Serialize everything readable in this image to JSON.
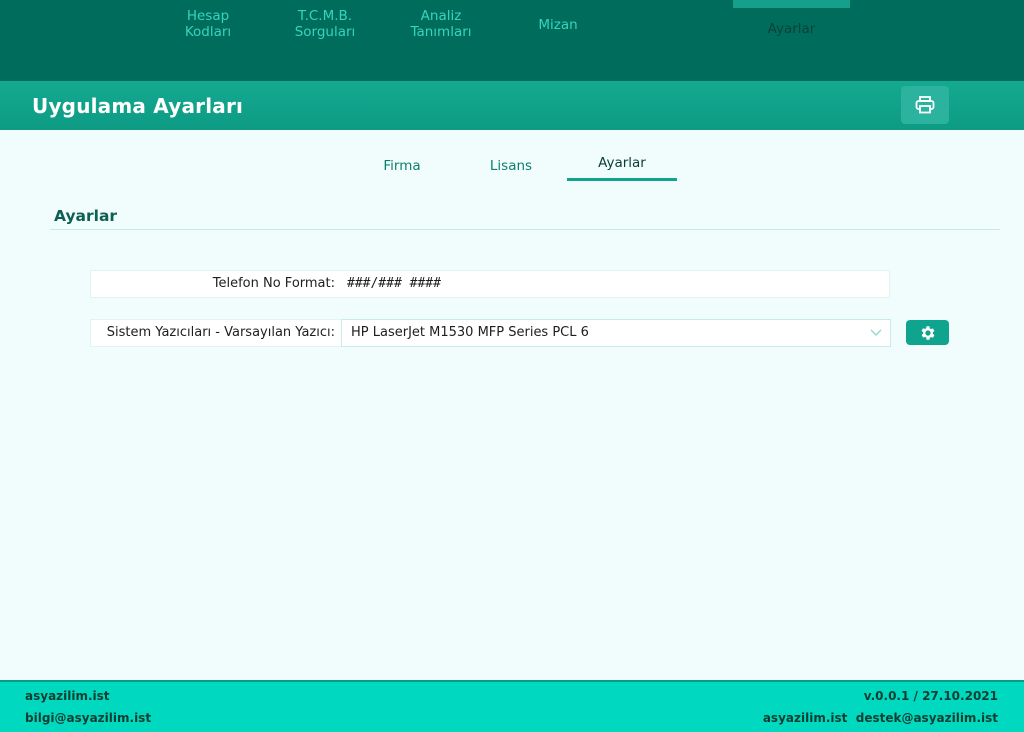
{
  "nav": {
    "items": [
      {
        "line1": "Hesap",
        "line2": "Kodları"
      },
      {
        "line1": "T.C.M.B.",
        "line2": "Sorguları"
      },
      {
        "line1": "Analiz",
        "line2": "Tanımları"
      },
      {
        "label": "Mizan"
      },
      {
        "label": "Ayarlar",
        "active": true
      }
    ]
  },
  "header": {
    "title": "Uygulama Ayarları",
    "print_icon": "printer-icon"
  },
  "tabs": [
    {
      "label": "Firma"
    },
    {
      "label": "Lisans"
    },
    {
      "label": "Ayarlar",
      "active": true
    }
  ],
  "section": {
    "title": "Ayarlar"
  },
  "form": {
    "phone_format_label": "Telefon No Format:",
    "phone_format_value": "###/### ####",
    "printer_label": "Sistem Yazıcıları - Varsayılan Yazıcı:",
    "printer_value": "HP LaserJet M1530 MFP Series PCL 6",
    "settings_icon": "gear-icon"
  },
  "footer": {
    "site": "asyazilim.ist",
    "email": "bilgi@asyazilim.ist",
    "version": "v.0.0.1 / 27.10.2021",
    "contact": "asyazilim.ist  destek@asyazilim.ist"
  },
  "colors": {
    "nav_bg": "#006d5c",
    "nav_text": "#36d4bd",
    "header_bg": "#14a990",
    "page_bg": "#f0fdfc",
    "accent": "#0ea48d",
    "footer_bg": "#00d9c0"
  }
}
